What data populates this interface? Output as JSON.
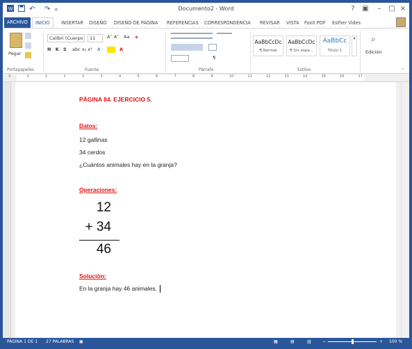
{
  "window": {
    "title": "Documento2 - Word",
    "controls": [
      "?",
      "▣",
      "–",
      "□",
      "×"
    ]
  },
  "quick_access": [
    "save-icon",
    "undo-icon",
    "redo-icon",
    "customize-icon"
  ],
  "tabs": [
    {
      "label": "ARCHIVO"
    },
    {
      "label": "INICIO"
    },
    {
      "label": "INSERTAR"
    },
    {
      "label": "DISEÑO"
    },
    {
      "label": "DISEÑO DE PÁGINA"
    },
    {
      "label": "REFERENCIAS"
    },
    {
      "label": "CORRESPONDENCIA"
    },
    {
      "label": "REVISAR"
    },
    {
      "label": "VISTA"
    },
    {
      "label": "Foxit PDF"
    }
  ],
  "user": {
    "name": "Esther Vides"
  },
  "ribbon": {
    "paste_label": "Pegar",
    "font_name": "Calibri (Cuerpo",
    "font_size": "11",
    "format_row": "N K S",
    "styles": [
      {
        "sample": "AaBbCcDc",
        "name": "¶ Normal"
      },
      {
        "sample": "AaBbCcDc",
        "name": "¶ Sin espa..."
      },
      {
        "sample": "AaBbCc",
        "name": "Título 1"
      }
    ],
    "edit_label": "Edición",
    "groups": {
      "clipboard": "Portapapeles",
      "font": "Fuente",
      "paragraph": "Párrafo",
      "styles": "Estilos"
    }
  },
  "ruler": {
    "numbers": [
      "3",
      "2",
      "1",
      "1",
      "2",
      "3",
      "4",
      "5",
      "6",
      "7",
      "8",
      "9",
      "10",
      "11",
      "12",
      "13",
      "14",
      "15",
      "16",
      "17"
    ]
  },
  "document": {
    "heading": "PÁGINA 84. EJERCICIO 5.",
    "datos_label": "Datos:",
    "datos_lines": [
      "12 gallinas",
      "34 cerdos",
      "¿Cuántos animales hay en la granja?"
    ],
    "operaciones_label": "Operaciones:",
    "operation": {
      "top": "12",
      "second": "+ 34",
      "result": "46"
    },
    "solucion_label": "Solución:",
    "solucion_text": "En la granja hay 46 animales."
  },
  "status": {
    "page": "PÁGINA 1 DE 1",
    "words": "27 PALABRAS",
    "zoom": "100 %"
  },
  "colors": {
    "accent": "#2b579a",
    "heading_red": "#e01010"
  }
}
